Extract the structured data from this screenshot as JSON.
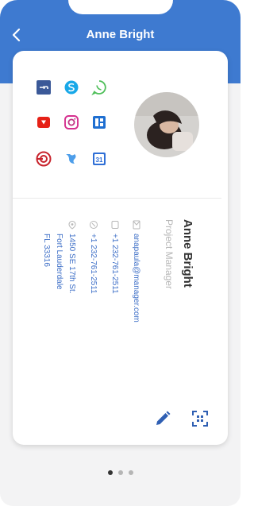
{
  "header": {
    "title": "Anne Bright"
  },
  "profile": {
    "name": "Anne Bright",
    "role": "Project Manager",
    "email": "anapaula@manager.com",
    "phone_1": "+1 232-761-2511",
    "phone_2": "+1 232-761-2511",
    "address_line_1": "1450 SE 17th St.",
    "address_line_2": "Fort Lauderdale",
    "address_line_3": "FL 33316"
  },
  "social_icons": [
    "facebook-icon",
    "skype-icon",
    "whatsapp-icon",
    "youtube-icon",
    "instagram-icon",
    "google-slides-icon",
    "pinterest-icon",
    "twitter-icon",
    "google-calendar-icon"
  ],
  "colors": {
    "accent": "#3e7ad0",
    "link_text": "#3e6fc7",
    "name_text": "#333333",
    "role_text": "#b6b6b6",
    "background": "#f3f3f4"
  },
  "pager": {
    "page_count": 3,
    "active_index": 0
  }
}
